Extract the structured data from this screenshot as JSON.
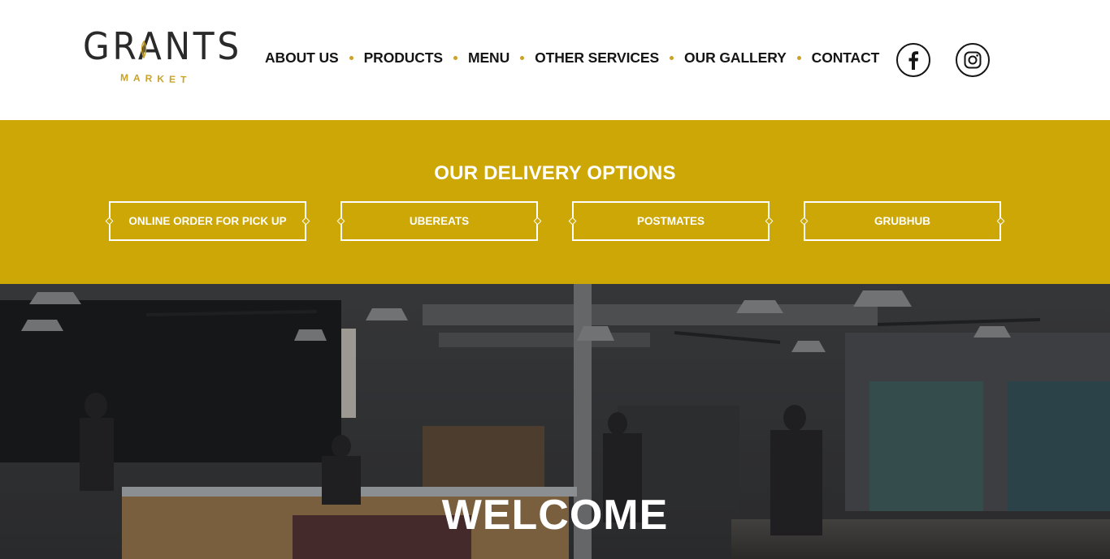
{
  "header": {
    "logo": {
      "wordmark": "GRANTS",
      "sub": "MARKET"
    },
    "nav": [
      {
        "label": "ABOUT US"
      },
      {
        "label": "PRODUCTS"
      },
      {
        "label": "MENU"
      },
      {
        "label": "OTHER SERVICES"
      },
      {
        "label": "OUR GALLERY"
      },
      {
        "label": "CONTACT"
      }
    ],
    "social": [
      {
        "icon": "facebook-icon"
      },
      {
        "icon": "instagram-icon"
      }
    ]
  },
  "delivery": {
    "title": "OUR DELIVERY OPTIONS",
    "buttons": [
      {
        "label": "ONLINE ORDER FOR PICK UP"
      },
      {
        "label": "UBEREATS"
      },
      {
        "label": "POSTMATES"
      },
      {
        "label": "GRUBHUB"
      }
    ]
  },
  "hero": {
    "title": "WELCOME",
    "image": "market-interior-photo"
  },
  "colors": {
    "accent": "#cda706",
    "text": "#151515",
    "logo_gold": "#c9a227"
  }
}
